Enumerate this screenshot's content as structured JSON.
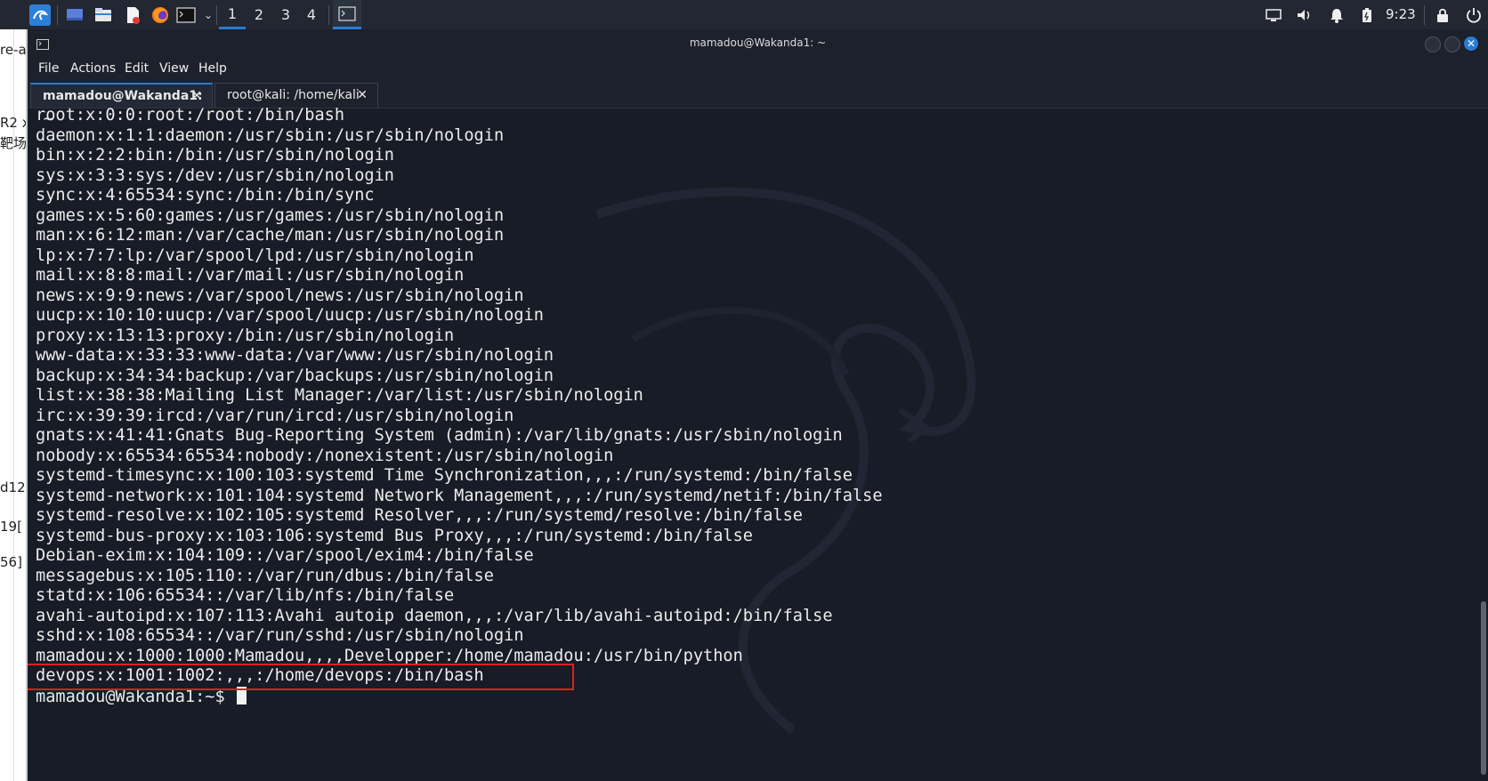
{
  "taskbar": {
    "workspaces": [
      "1",
      "2",
      "3",
      "4"
    ],
    "active_workspace": "1",
    "clock": "9:23",
    "accent": "#2a7bd4"
  },
  "left_strip": {
    "fragments": [
      "re-a",
      "R2 x",
      "靶场",
      "d12",
      "19[",
      "56]"
    ]
  },
  "window": {
    "title": "mamadou@Wakanda1: ~",
    "menu": [
      "File",
      "Actions",
      "Edit",
      "View",
      "Help"
    ],
    "tabs": [
      {
        "label": "mamadou@Wakanda1: ~",
        "active": true
      },
      {
        "label": "root@kali: /home/kali",
        "active": false
      }
    ]
  },
  "terminal": {
    "lines": [
      "root:x:0:0:root:/root:/bin/bash",
      "daemon:x:1:1:daemon:/usr/sbin:/usr/sbin/nologin",
      "bin:x:2:2:bin:/bin:/usr/sbin/nologin",
      "sys:x:3:3:sys:/dev:/usr/sbin/nologin",
      "sync:x:4:65534:sync:/bin:/bin/sync",
      "games:x:5:60:games:/usr/games:/usr/sbin/nologin",
      "man:x:6:12:man:/var/cache/man:/usr/sbin/nologin",
      "lp:x:7:7:lp:/var/spool/lpd:/usr/sbin/nologin",
      "mail:x:8:8:mail:/var/mail:/usr/sbin/nologin",
      "news:x:9:9:news:/var/spool/news:/usr/sbin/nologin",
      "uucp:x:10:10:uucp:/var/spool/uucp:/usr/sbin/nologin",
      "proxy:x:13:13:proxy:/bin:/usr/sbin/nologin",
      "www-data:x:33:33:www-data:/var/www:/usr/sbin/nologin",
      "backup:x:34:34:backup:/var/backups:/usr/sbin/nologin",
      "list:x:38:38:Mailing List Manager:/var/list:/usr/sbin/nologin",
      "irc:x:39:39:ircd:/var/run/ircd:/usr/sbin/nologin",
      "gnats:x:41:41:Gnats Bug-Reporting System (admin):/var/lib/gnats:/usr/sbin/nologin",
      "nobody:x:65534:65534:nobody:/nonexistent:/usr/sbin/nologin",
      "systemd-timesync:x:100:103:systemd Time Synchronization,,,:/run/systemd:/bin/false",
      "systemd-network:x:101:104:systemd Network Management,,,:/run/systemd/netif:/bin/false",
      "systemd-resolve:x:102:105:systemd Resolver,,,:/run/systemd/resolve:/bin/false",
      "systemd-bus-proxy:x:103:106:systemd Bus Proxy,,,:/run/systemd:/bin/false",
      "Debian-exim:x:104:109::/var/spool/exim4:/bin/false",
      "messagebus:x:105:110::/var/run/dbus:/bin/false",
      "statd:x:106:65534::/var/lib/nfs:/bin/false",
      "avahi-autoipd:x:107:113:Avahi autoip daemon,,,:/var/lib/avahi-autoipd:/bin/false",
      "sshd:x:108:65534::/var/run/sshd:/usr/sbin/nologin",
      "mamadou:x:1000:1000:Mamadou,,,,Developper:/home/mamadou:/usr/bin/python",
      "devops:x:1001:1002:,,,:/home/devops:/bin/bash"
    ],
    "prompt": "mamadou@Wakanda1:~$ ",
    "highlight_color": "#e02020"
  }
}
